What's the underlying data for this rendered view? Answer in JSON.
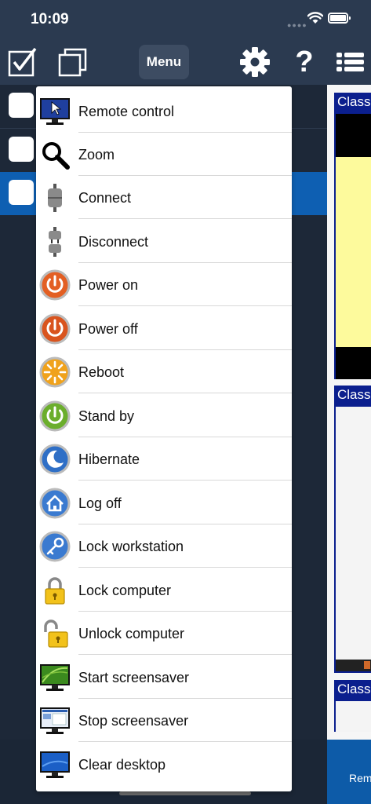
{
  "status_bar": {
    "time": "10:09"
  },
  "toolbar": {
    "menu_label": "Menu"
  },
  "popup_menu": {
    "items": [
      {
        "label": "Remote control",
        "icon": "remote-control-icon"
      },
      {
        "label": "Zoom",
        "icon": "zoom-icon"
      },
      {
        "label": "Connect",
        "icon": "connect-icon"
      },
      {
        "label": "Disconnect",
        "icon": "disconnect-icon"
      },
      {
        "label": "Power on",
        "icon": "power-on-icon"
      },
      {
        "label": "Power off",
        "icon": "power-off-icon"
      },
      {
        "label": "Reboot",
        "icon": "reboot-icon"
      },
      {
        "label": "Stand by",
        "icon": "stand-by-icon"
      },
      {
        "label": "Hibernate",
        "icon": "hibernate-icon"
      },
      {
        "label": "Log off",
        "icon": "log-off-icon"
      },
      {
        "label": "Lock workstation",
        "icon": "lock-workstation-icon"
      },
      {
        "label": "Lock computer",
        "icon": "lock-computer-icon"
      },
      {
        "label": "Unlock computer",
        "icon": "unlock-computer-icon"
      },
      {
        "label": "Start screensaver",
        "icon": "start-screensaver-icon"
      },
      {
        "label": "Stop screensaver",
        "icon": "stop-screensaver-icon"
      },
      {
        "label": "Clear desktop",
        "icon": "clear-desktop-icon"
      }
    ]
  },
  "thumbnails": [
    {
      "title": "Class"
    },
    {
      "title": "Class"
    },
    {
      "title": "Class"
    }
  ],
  "bottom_bar": {
    "label": "Rem"
  },
  "colors": {
    "toolbar_bg": "#2b3a50",
    "selection": "#0e5fb2",
    "thumbnail_header": "#0b1f8e",
    "bottom_right": "#0d5ba8"
  }
}
